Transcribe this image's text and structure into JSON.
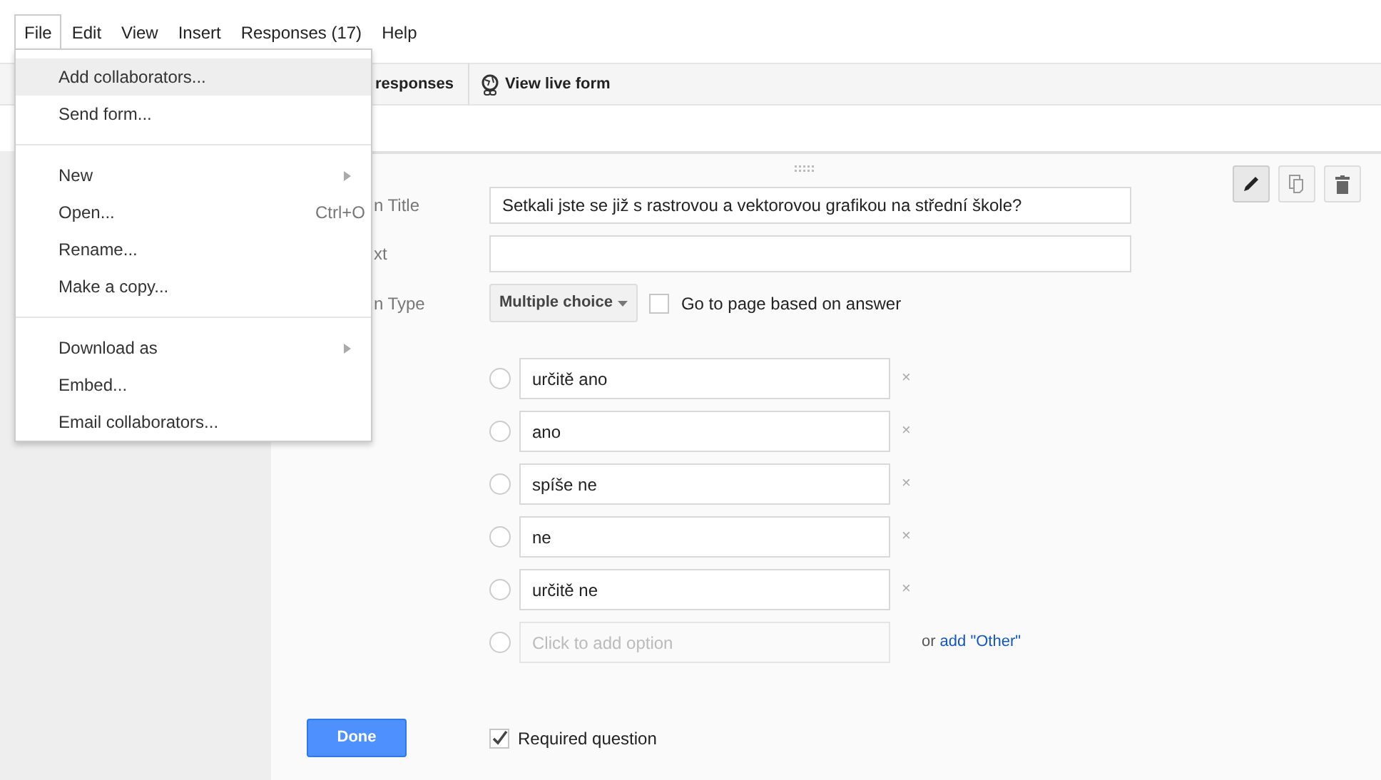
{
  "menubar": [
    {
      "label": "File",
      "selected": true
    },
    {
      "label": "Edit",
      "selected": false
    },
    {
      "label": "View",
      "selected": false
    },
    {
      "label": "Insert",
      "selected": false
    },
    {
      "label": "Responses (17)",
      "selected": false
    },
    {
      "label": "Help",
      "selected": false
    }
  ],
  "file_menu": [
    {
      "kind": "item",
      "label": "Add collaborators...",
      "selected": true
    },
    {
      "kind": "item",
      "label": "Send form...",
      "selected": false
    },
    {
      "kind": "divider"
    },
    {
      "kind": "submenu",
      "label": "New",
      "selected": false
    },
    {
      "kind": "item",
      "label": "Open...",
      "shortcut": "Ctrl+O",
      "selected": false
    },
    {
      "kind": "item",
      "label": "Rename...",
      "selected": false
    },
    {
      "kind": "item",
      "label": "Make a copy...",
      "selected": false
    },
    {
      "kind": "divider"
    },
    {
      "kind": "submenu",
      "label": "Download as",
      "selected": false
    },
    {
      "kind": "item",
      "label": "Embed...",
      "selected": false
    },
    {
      "kind": "item",
      "label": "Email collaborators...",
      "selected": false
    }
  ],
  "toolbar": {
    "responses_label": "responses",
    "view_live_form": "View live form"
  },
  "question": {
    "title_label": "n Title",
    "title_value": "Setkali jste se již s rastrovou a vektorovou grafikou na střední škole?",
    "help_label": "xt",
    "type_label": "n Type",
    "type_value": "Multiple choice",
    "go_to_page": {
      "label": "Go to page based on answer",
      "checked": false
    },
    "options": [
      {
        "value": "určitě ano",
        "selected": false
      },
      {
        "value": "ano",
        "selected": false
      },
      {
        "value": "spíše ne",
        "selected": false
      },
      {
        "value": "ne",
        "selected": false
      },
      {
        "value": "určitě ne",
        "selected": false
      }
    ],
    "add_option_placeholder": "Click to add option",
    "remove_mark": "×",
    "or_text": "or",
    "add_other": "add \"Other\"",
    "done": "Done",
    "required": {
      "label": "Required question",
      "checked": true
    }
  }
}
